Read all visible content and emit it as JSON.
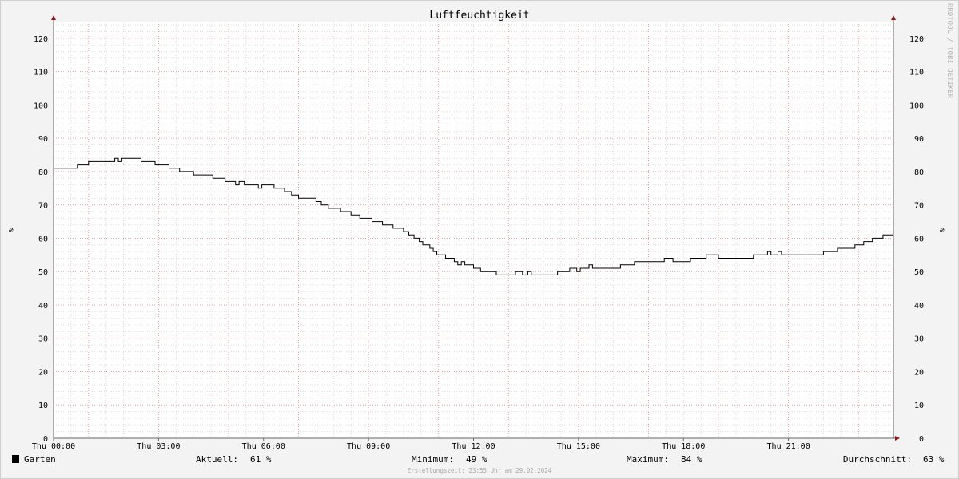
{
  "chart_data": {
    "type": "line",
    "title": "Luftfeuchtigkeit",
    "ylabel": "%",
    "watermark": "RRDTOOL / TOBI OETIKER",
    "ylim": [
      0,
      125
    ],
    "xlim": [
      0,
      24
    ],
    "y_ticks": [
      0,
      10,
      20,
      30,
      40,
      50,
      60,
      70,
      80,
      90,
      100,
      110,
      120
    ],
    "x_ticks": [
      {
        "x": 0,
        "label": "Thu 00:00"
      },
      {
        "x": 3,
        "label": "Thu 03:00"
      },
      {
        "x": 6,
        "label": "Thu 06:00"
      },
      {
        "x": 9,
        "label": "Thu 09:00"
      },
      {
        "x": 12,
        "label": "Thu 12:00"
      },
      {
        "x": 15,
        "label": "Thu 15:00"
      },
      {
        "x": 18,
        "label": "Thu 18:00"
      },
      {
        "x": 21,
        "label": "Thu 21:00"
      }
    ],
    "grid": true,
    "series": [
      {
        "name": "Garten",
        "color": "#000000",
        "points": [
          [
            0.0,
            81
          ],
          [
            0.68,
            82
          ],
          [
            1.0,
            83
          ],
          [
            1.75,
            84
          ],
          [
            1.85,
            83
          ],
          [
            1.95,
            84
          ],
          [
            2.5,
            83
          ],
          [
            2.9,
            82
          ],
          [
            3.3,
            81
          ],
          [
            3.6,
            80
          ],
          [
            4.0,
            79
          ],
          [
            4.55,
            78
          ],
          [
            4.9,
            77
          ],
          [
            5.2,
            76
          ],
          [
            5.3,
            77
          ],
          [
            5.45,
            76
          ],
          [
            5.85,
            75
          ],
          [
            5.95,
            76
          ],
          [
            6.3,
            75
          ],
          [
            6.6,
            74
          ],
          [
            6.8,
            73
          ],
          [
            7.0,
            72
          ],
          [
            7.5,
            71
          ],
          [
            7.65,
            70
          ],
          [
            7.85,
            69
          ],
          [
            8.2,
            68
          ],
          [
            8.5,
            67
          ],
          [
            8.75,
            66
          ],
          [
            9.1,
            65
          ],
          [
            9.4,
            64
          ],
          [
            9.7,
            63
          ],
          [
            10.0,
            62
          ],
          [
            10.15,
            61
          ],
          [
            10.3,
            60
          ],
          [
            10.45,
            59
          ],
          [
            10.55,
            58
          ],
          [
            10.75,
            57
          ],
          [
            10.85,
            56
          ],
          [
            10.95,
            55
          ],
          [
            11.2,
            54
          ],
          [
            11.45,
            53
          ],
          [
            11.55,
            52
          ],
          [
            11.65,
            53
          ],
          [
            11.75,
            52
          ],
          [
            12.0,
            51
          ],
          [
            12.2,
            50
          ],
          [
            12.65,
            49
          ],
          [
            13.2,
            50
          ],
          [
            13.4,
            49
          ],
          [
            13.55,
            50
          ],
          [
            13.65,
            49
          ],
          [
            14.4,
            50
          ],
          [
            14.75,
            51
          ],
          [
            14.95,
            50
          ],
          [
            15.05,
            51
          ],
          [
            15.3,
            52
          ],
          [
            15.4,
            51
          ],
          [
            16.2,
            52
          ],
          [
            16.6,
            53
          ],
          [
            17.45,
            54
          ],
          [
            17.7,
            53
          ],
          [
            18.2,
            54
          ],
          [
            18.65,
            55
          ],
          [
            19.0,
            54
          ],
          [
            20.0,
            55
          ],
          [
            20.4,
            56
          ],
          [
            20.5,
            55
          ],
          [
            20.7,
            56
          ],
          [
            20.8,
            55
          ],
          [
            22.0,
            56
          ],
          [
            22.4,
            57
          ],
          [
            22.9,
            58
          ],
          [
            23.15,
            59
          ],
          [
            23.4,
            60
          ],
          [
            23.7,
            61
          ],
          [
            24.0,
            61
          ]
        ]
      }
    ],
    "legend": {
      "name": "Garten",
      "stats": [
        {
          "label": "Aktuell:",
          "value": "61 %"
        },
        {
          "label": "Minimum:",
          "value": "49 %"
        },
        {
          "label": "Maximum:",
          "value": "84 %"
        },
        {
          "label": "Durchschnitt:",
          "value": "63 %"
        }
      ]
    },
    "footer": "Erstellungszeit: 23:55 Uhr am 29.02.2024"
  }
}
